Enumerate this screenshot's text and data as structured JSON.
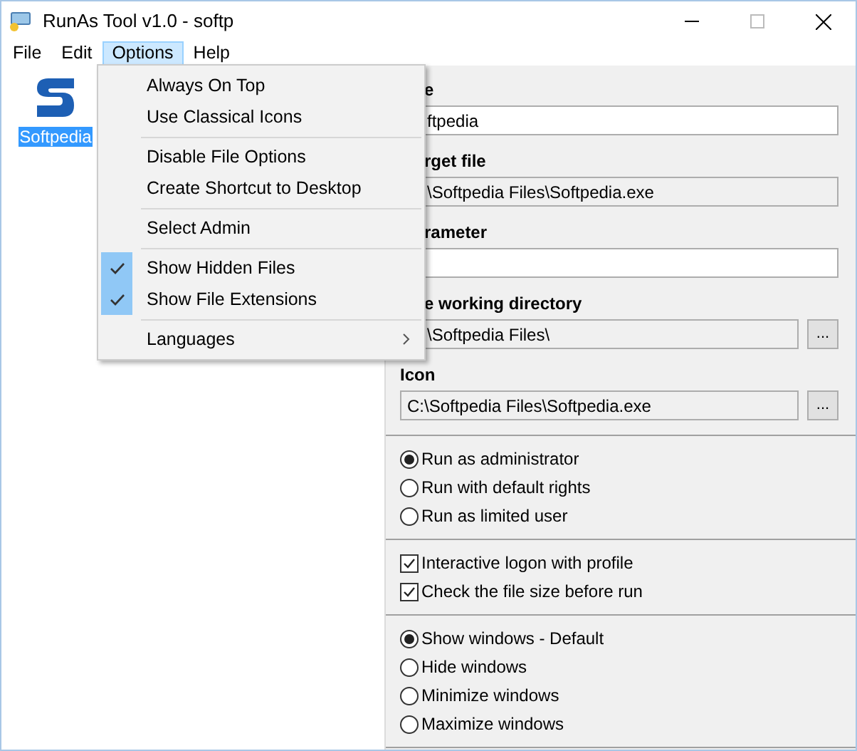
{
  "window": {
    "title": "RunAs Tool v1.0 - softp"
  },
  "menubar": [
    {
      "label": "File",
      "selected": false
    },
    {
      "label": "Edit",
      "selected": false
    },
    {
      "label": "Options",
      "selected": true
    },
    {
      "label": "Help",
      "selected": false
    }
  ],
  "options_menu": [
    {
      "kind": "item",
      "label": "Always On Top",
      "checked": false
    },
    {
      "kind": "item",
      "label": "Use Classical Icons",
      "checked": false
    },
    {
      "kind": "separator"
    },
    {
      "kind": "item",
      "label": "Disable File Options",
      "checked": false
    },
    {
      "kind": "item",
      "label": "Create Shortcut to Desktop",
      "checked": false
    },
    {
      "kind": "separator"
    },
    {
      "kind": "item",
      "label": "Select Admin",
      "checked": false
    },
    {
      "kind": "separator"
    },
    {
      "kind": "item",
      "label": "Show Hidden Files",
      "checked": true
    },
    {
      "kind": "item",
      "label": "Show File Extensions",
      "checked": true
    },
    {
      "kind": "separator"
    },
    {
      "kind": "submenu",
      "label": "Languages",
      "checked": false
    }
  ],
  "entries": [
    {
      "label": "Softpedia",
      "selected": true
    }
  ],
  "fields": [
    {
      "label": "e",
      "value": "ftpedia",
      "kind": "editable",
      "covered": true
    },
    {
      "label": "rget file",
      "value": "\\Softpedia Files\\Softpedia.exe",
      "kind": "readonly",
      "covered": true
    },
    {
      "label": "rameter",
      "kind": "editable",
      "covered": true
    },
    {
      "label": "e working directory",
      "value": "\\Softpedia Files\\",
      "kind": "readonly",
      "button": "...",
      "covered": true
    },
    {
      "label": "Icon",
      "value": "C:\\Softpedia Files\\Softpedia.exe",
      "kind": "readonly",
      "button": "...",
      "covered": false
    }
  ],
  "groups": [
    {
      "kind": "radio",
      "options": [
        {
          "label": "Run as administrator",
          "selected": true
        },
        {
          "label": "Run with default rights",
          "selected": false
        },
        {
          "label": "Run as limited user",
          "selected": false
        }
      ]
    },
    {
      "kind": "checkbox",
      "options": [
        {
          "label": "Interactive logon with profile",
          "checked": true
        },
        {
          "label": "Check the file size before run",
          "checked": true
        }
      ]
    },
    {
      "kind": "radio",
      "options": [
        {
          "label": "Show windows - Default",
          "selected": true
        },
        {
          "label": "Hide windows",
          "selected": false
        },
        {
          "label": "Minimize windows",
          "selected": false
        },
        {
          "label": "Maximize windows",
          "selected": false
        }
      ]
    }
  ]
}
